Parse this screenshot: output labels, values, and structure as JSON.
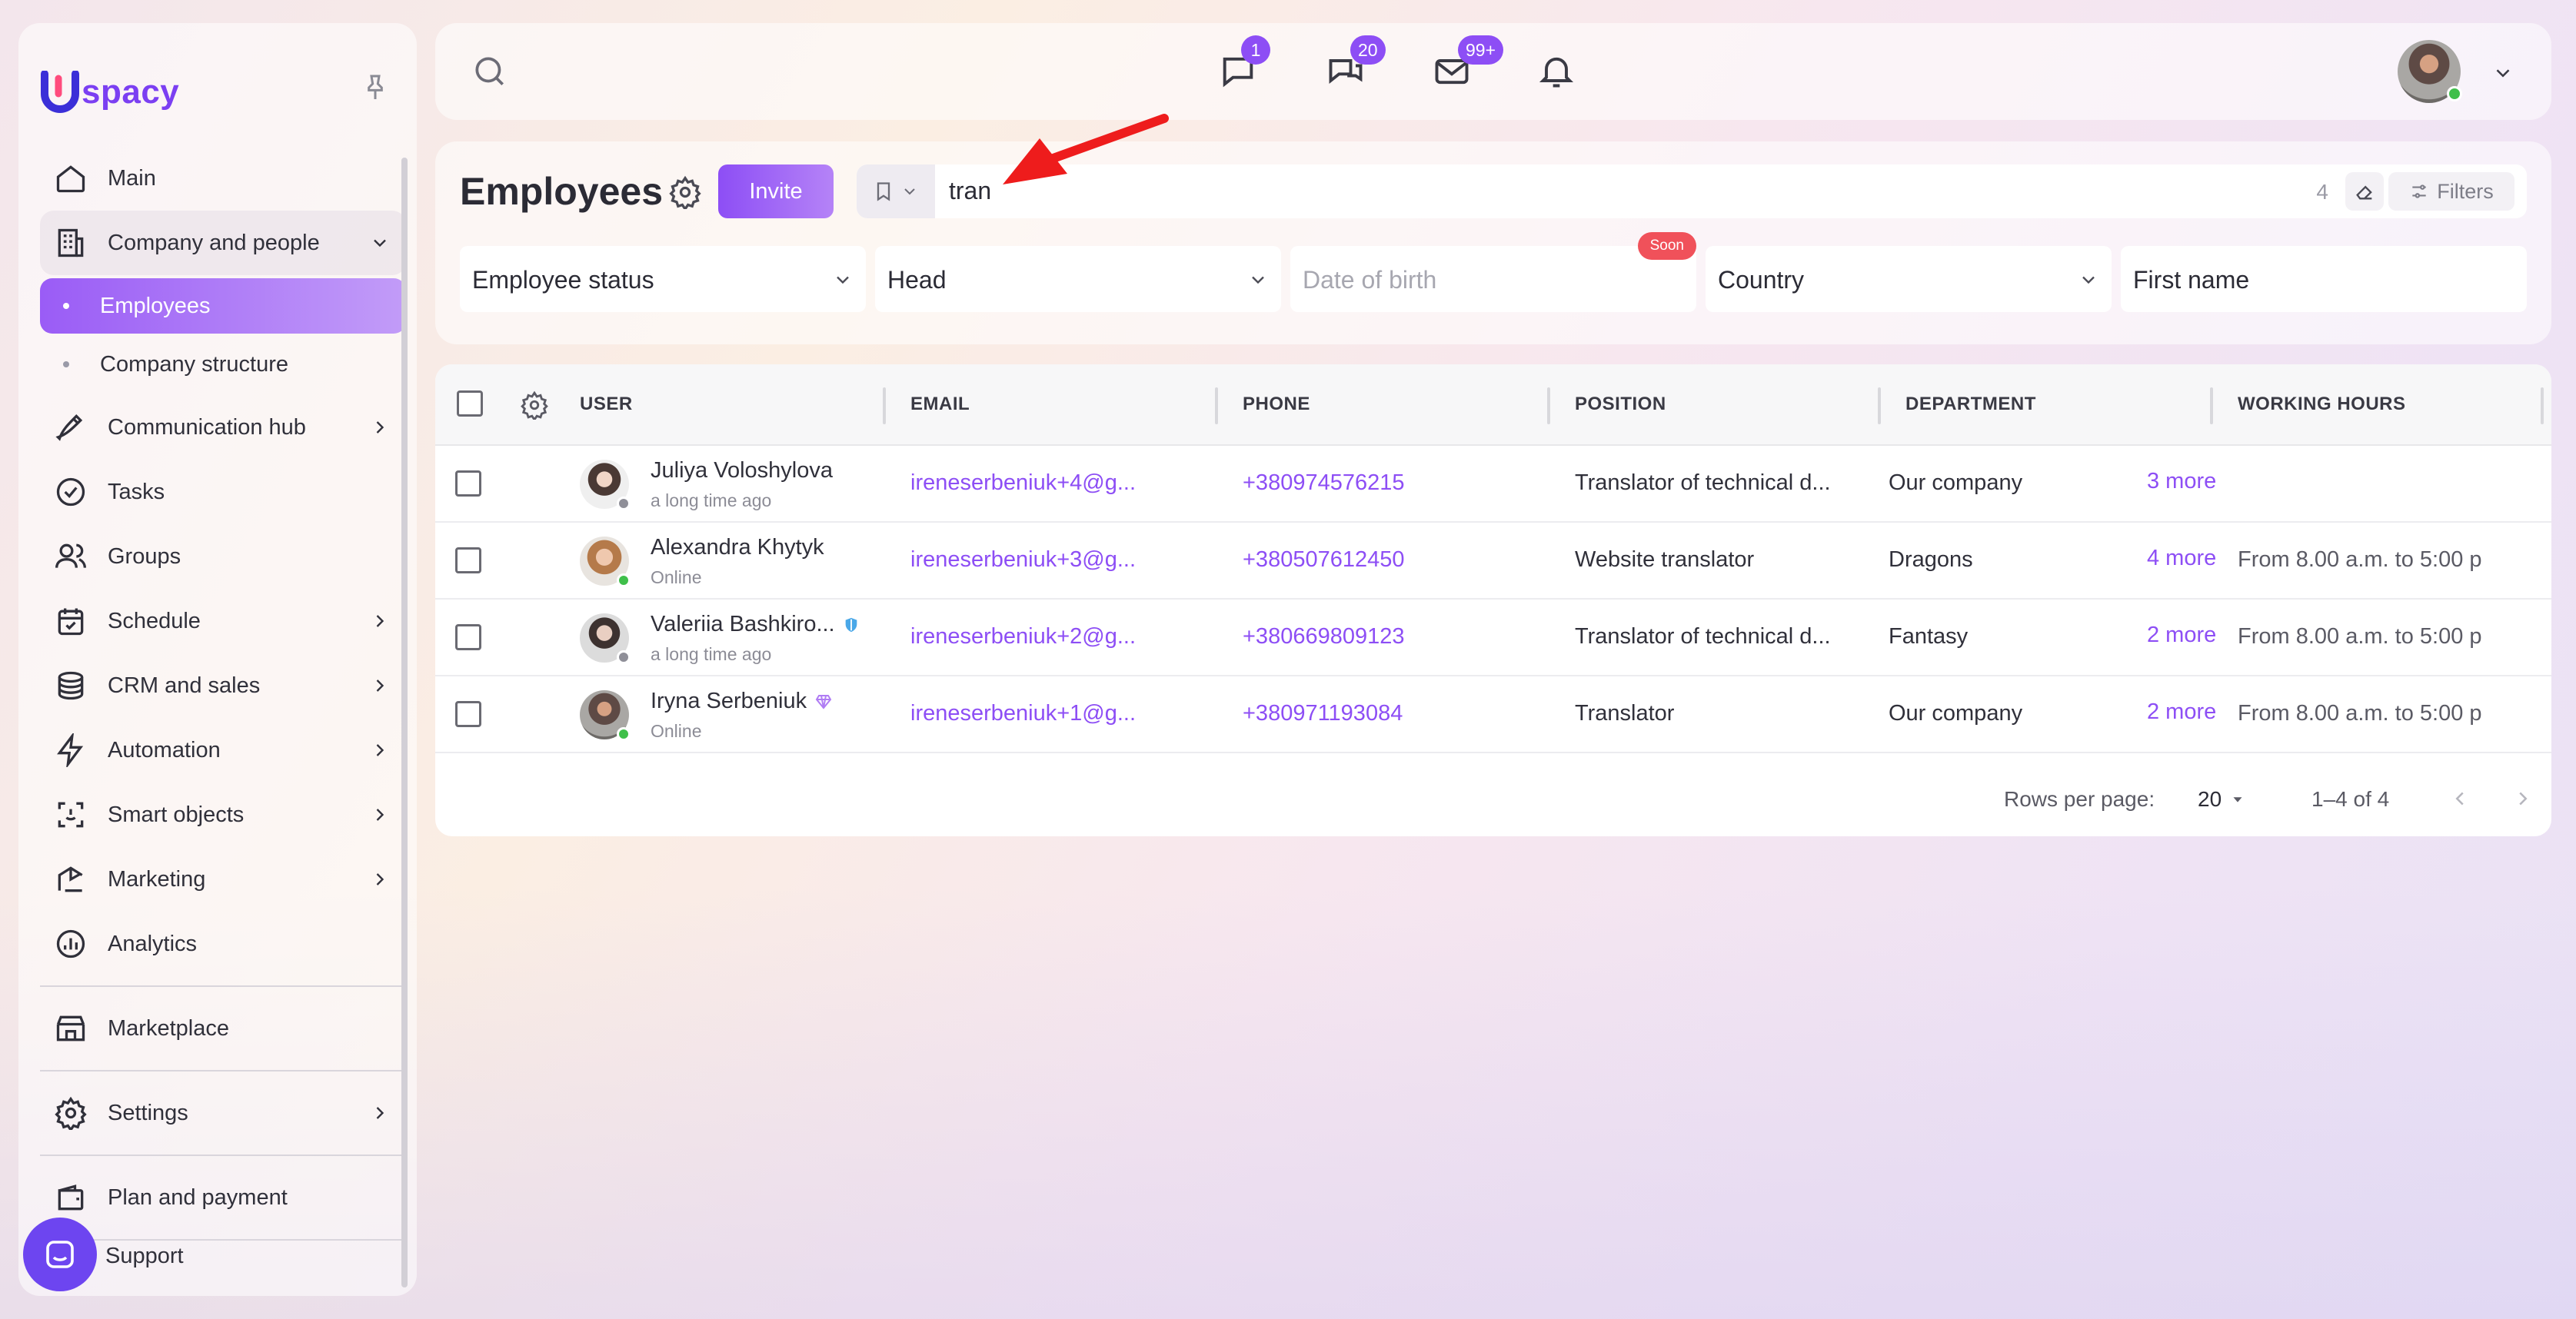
{
  "app": {
    "logo_text": "spacy",
    "brand_color": "#8d4ef5"
  },
  "sidebar": {
    "items": [
      {
        "label": "Main",
        "icon": "home-icon"
      },
      {
        "label": "Company and people",
        "icon": "building-icon"
      },
      {
        "label": "Employees"
      },
      {
        "label": "Company structure"
      },
      {
        "label": "Communication hub",
        "icon": "edit-icon"
      },
      {
        "label": "Tasks",
        "icon": "check-circle-icon"
      },
      {
        "label": "Groups",
        "icon": "users-icon"
      },
      {
        "label": "Schedule",
        "icon": "calendar-icon"
      },
      {
        "label": "CRM and sales",
        "icon": "coins-icon"
      },
      {
        "label": "Automation",
        "icon": "bolt-icon"
      },
      {
        "label": "Smart objects",
        "icon": "scan-icon"
      },
      {
        "label": "Marketing",
        "icon": "megaphone-icon"
      },
      {
        "label": "Analytics",
        "icon": "chart-icon"
      },
      {
        "label": "Marketplace",
        "icon": "store-icon"
      },
      {
        "label": "Settings",
        "icon": "gear-icon"
      },
      {
        "label": "Plan and payment",
        "icon": "wallet-icon"
      },
      {
        "label": "Support",
        "icon": "chat-icon"
      }
    ]
  },
  "topbar": {
    "badges": {
      "chat": "1",
      "messages": "20",
      "mail": "99+"
    }
  },
  "header": {
    "title": "Employees",
    "invite_label": "Invite",
    "search_value": "tran",
    "result_count": "4",
    "filters_label": "Filters"
  },
  "filters": {
    "employee_status": "Employee status",
    "head": "Head",
    "date_of_birth": "Date of birth",
    "soon_badge": "Soon",
    "country": "Country",
    "first_name": "First name"
  },
  "table": {
    "columns": [
      "USER",
      "EMAIL",
      "PHONE",
      "POSITION",
      "DEPARTMENT",
      "WORKING HOURS"
    ],
    "rows": [
      {
        "name": "Juliya Voloshylova",
        "status": "a long time ago",
        "online": false,
        "email": "ireneserbeniuk+4@g...",
        "phone": "+380974576215",
        "position": "Translator of technical d...",
        "department": "Our company",
        "more": "3 more",
        "hours": ""
      },
      {
        "name": "Alexandra Khytyk",
        "status": "Online",
        "online": true,
        "email": "ireneserbeniuk+3@g...",
        "phone": "+380507612450",
        "position": "Website translator",
        "department": "Dragons",
        "more": "4 more",
        "hours": "From 8.00 a.m. to 5:00 p"
      },
      {
        "name": "Valeriia Bashkiro...",
        "status": "a long time ago",
        "online": false,
        "email": "ireneserbeniuk+2@g...",
        "phone": "+380669809123",
        "position": "Translator of technical d...",
        "department": "Fantasy",
        "more": "2 more",
        "hours": "From 8.00 a.m. to 5:00 p"
      },
      {
        "name": "Iryna Serbeniuk",
        "status": "Online",
        "online": true,
        "email": "ireneserbeniuk+1@g...",
        "phone": "+380971193084",
        "position": "Translator",
        "department": "Our company",
        "more": "2 more",
        "hours": "From 8.00 a.m. to 5:00 p"
      }
    ]
  },
  "pagination": {
    "rows_per_page_label": "Rows per page:",
    "rows_per_page": "20",
    "range": "1–4 of 4"
  }
}
